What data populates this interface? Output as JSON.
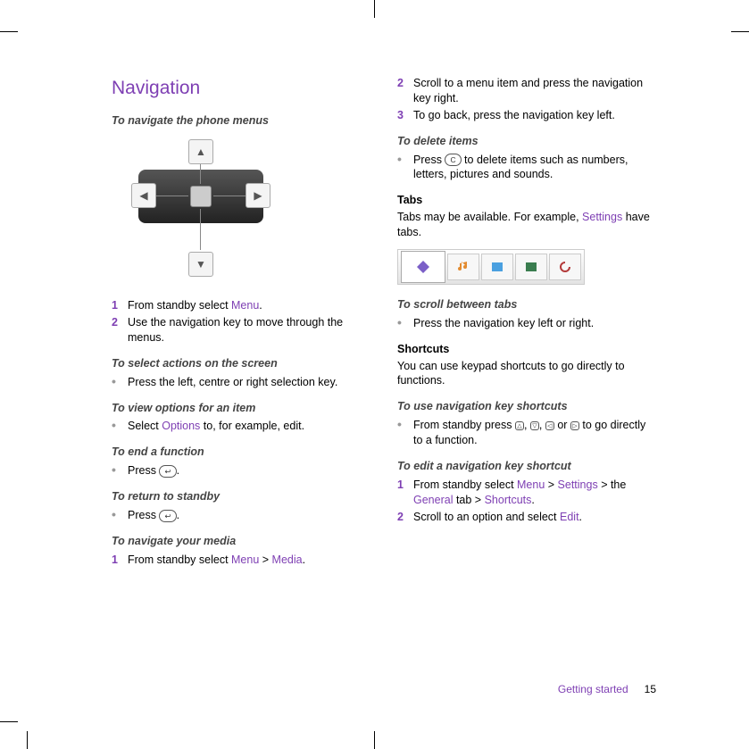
{
  "col1": {
    "title": "Navigation",
    "h_navigate_menus": "To navigate the phone menus",
    "step1": {
      "num": "1",
      "pre": "From standby select ",
      "ui": "Menu",
      "post": "."
    },
    "step2": {
      "num": "2",
      "txt": "Use the navigation key to move through the menus."
    },
    "h_select_actions": "To select actions on the screen",
    "b_select_actions": "Press the left, centre or right selection key.",
    "h_view_options": "To view options for an item",
    "b_view_options_pre": "Select ",
    "b_view_options_ui": "Options",
    "b_view_options_post": " to, for example, edit.",
    "h_end_function": "To end a function",
    "b_end_function_pre": "Press ",
    "b_end_function_key": "↩",
    "b_end_function_post": ".",
    "h_return_standby": "To return to standby",
    "b_return_standby_pre": "Press ",
    "b_return_standby_key": "↩",
    "b_return_standby_post": ".",
    "h_navigate_media": "To navigate your media",
    "media_step_num": "1",
    "media_step_pre": "From standby select ",
    "media_step_ui1": "Menu",
    "media_step_sep": " > ",
    "media_step_ui2": "Media",
    "media_step_post": "."
  },
  "col2": {
    "cont_step2_num": "2",
    "cont_step2_txt": "Scroll to a menu item and press the navigation key right.",
    "cont_step3_num": "3",
    "cont_step3_txt": "To go back, press the navigation key left.",
    "h_delete": "To delete items",
    "b_delete_pre": "Press ",
    "b_delete_key": "C",
    "b_delete_post": " to delete items such as numbers, letters, pictures and sounds.",
    "h_tabs": "Tabs",
    "tabs_txt_pre": "Tabs may be available. For example, ",
    "tabs_txt_ui": "Settings",
    "tabs_txt_post": " have tabs.",
    "h_scroll_tabs": "To scroll between tabs",
    "b_scroll_tabs": "Press the navigation key left or right.",
    "h_shortcuts": "Shortcuts",
    "shortcuts_txt": "You can use keypad shortcuts to go directly to functions.",
    "h_use_nav": "To use navigation key shortcuts",
    "b_use_nav_pre": "From standby press ",
    "b_use_nav_k1": "△",
    "b_use_nav_c1": ", ",
    "b_use_nav_k2": "▽",
    "b_use_nav_c2": ", ",
    "b_use_nav_k3": "◁",
    "b_use_nav_or": " or ",
    "b_use_nav_k4": "▷",
    "b_use_nav_post": " to go directly to a function.",
    "h_edit_nav": "To edit a navigation key shortcut",
    "edit_s1_num": "1",
    "edit_s1_pre": "From standby select ",
    "edit_s1_u1": "Menu",
    "edit_s1_s1": " > ",
    "edit_s1_u2": "Settings",
    "edit_s1_s2": " > the ",
    "edit_s1_u3": "General",
    "edit_s1_s3": " tab > ",
    "edit_s1_u4": "Shortcuts",
    "edit_s1_post": ".",
    "edit_s2_num": "2",
    "edit_s2_pre": "Scroll to an option and select ",
    "edit_s2_ui": "Edit",
    "edit_s2_post": "."
  },
  "footer": {
    "section": "Getting started",
    "page": "15"
  }
}
